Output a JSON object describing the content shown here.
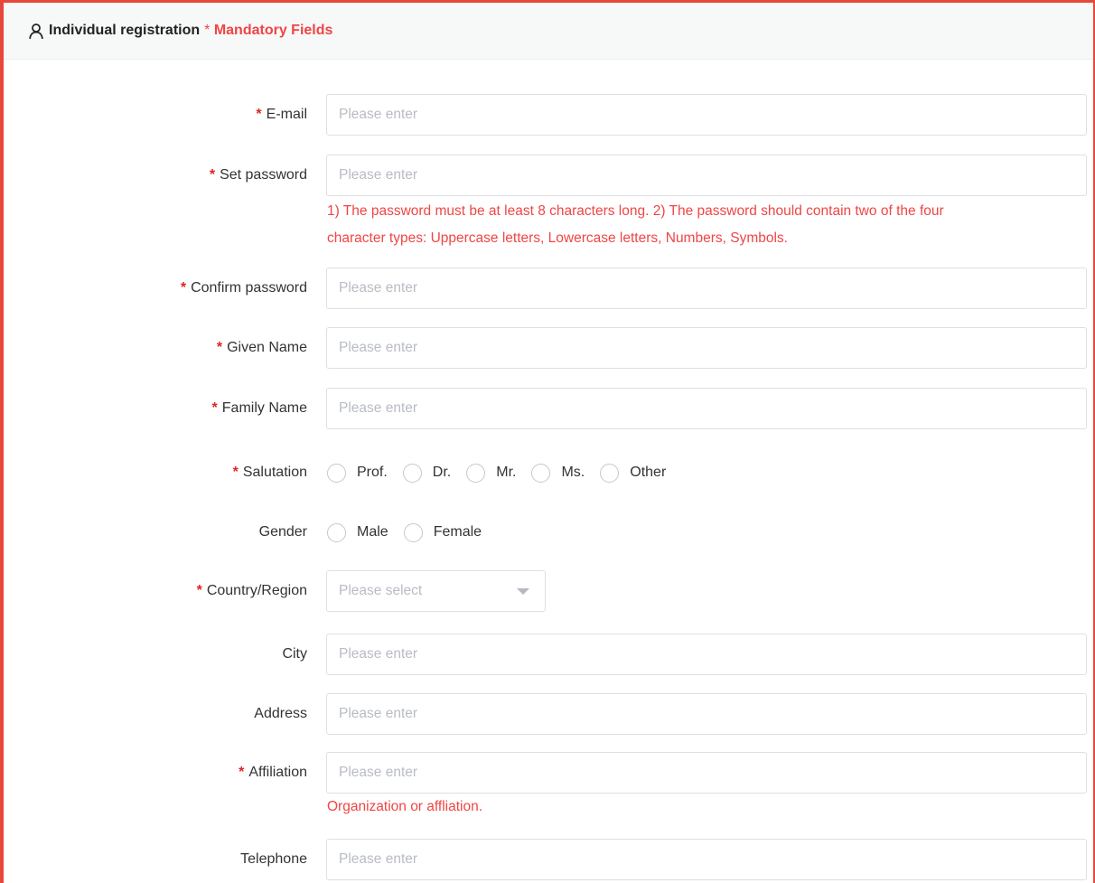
{
  "header": {
    "title": "Individual registration",
    "mandatory_star": "*",
    "mandatory_text": "Mandatory Fields"
  },
  "form": {
    "required_mark": "*",
    "email": {
      "label": "E-mail",
      "placeholder": "Please enter",
      "value": ""
    },
    "password": {
      "label": "Set password",
      "placeholder": "Please enter",
      "value": "",
      "hint_line1": "1) The password must be at least 8 characters long. 2) The password should contain two of the four",
      "hint_line2": "character types: Uppercase letters, Lowercase letters, Numbers, Symbols."
    },
    "confirm_password": {
      "label": "Confirm password",
      "placeholder": "Please enter",
      "value": ""
    },
    "given_name": {
      "label": "Given Name",
      "placeholder": "Please enter",
      "value": ""
    },
    "family_name": {
      "label": "Family Name",
      "placeholder": "Please enter",
      "value": ""
    },
    "salutation": {
      "label": "Salutation",
      "options": [
        "Prof.",
        "Dr.",
        "Mr.",
        "Ms.",
        "Other"
      ],
      "selected": null
    },
    "gender": {
      "label": "Gender",
      "options": [
        "Male",
        "Female"
      ],
      "selected": null
    },
    "country": {
      "label": "Country/Region",
      "placeholder": "Please select",
      "value": ""
    },
    "city": {
      "label": "City",
      "placeholder": "Please enter",
      "value": ""
    },
    "address": {
      "label": "Address",
      "placeholder": "Please enter",
      "value": ""
    },
    "affiliation": {
      "label": "Affiliation",
      "placeholder": "Please enter",
      "value": "",
      "hint": "Organization or affliation."
    },
    "telephone": {
      "label": "Telephone",
      "placeholder": "Please enter",
      "value": ""
    }
  },
  "colors": {
    "accent": "#e8473a",
    "error_text": "#f04545",
    "required_star": "#e02424",
    "placeholder": "#b8bcc3",
    "border": "#dcdfe4",
    "header_bg": "#f7f8f8"
  },
  "icons": {
    "header": "user-icon",
    "select": "caret-down-icon"
  }
}
